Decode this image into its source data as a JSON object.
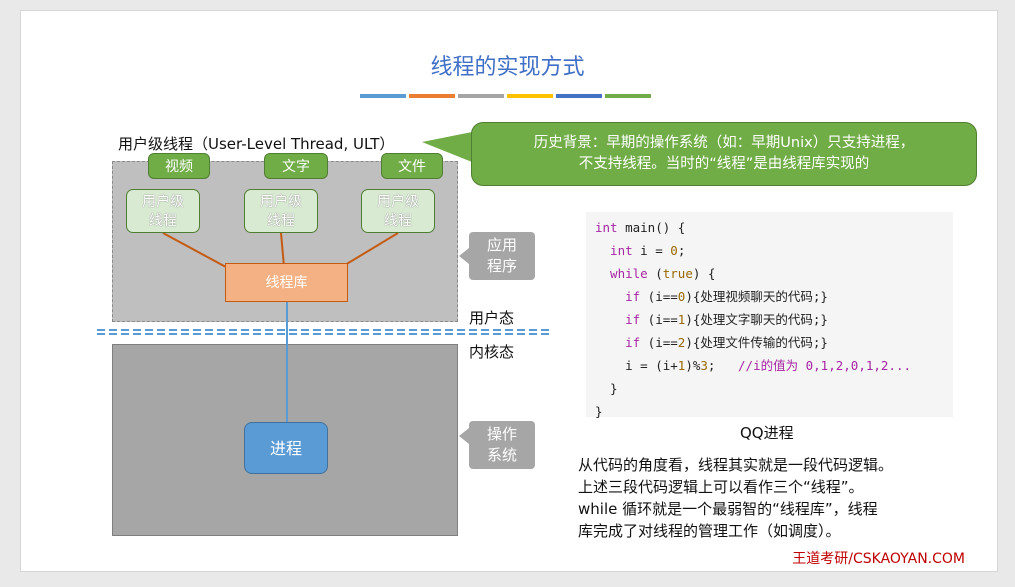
{
  "title": "线程的实现方式",
  "stripe_colors": [
    "#5b9bd5",
    "#ed7d31",
    "#a5a5a5",
    "#ffc000",
    "#4472c4",
    "#70ad47"
  ],
  "user_level_label": "用户级线程（User-Level Thread, ULT）",
  "callout": {
    "line1": "历史背景：早期的操作系统（如：早期Unix）只支持进程，",
    "line2": "不支持线程。当时的“线程”是由线程库实现的"
  },
  "tags": [
    "视频",
    "文字",
    "文件"
  ],
  "thread_label": {
    "line1": "用户级",
    "line2": "线程"
  },
  "thread_library": "线程库",
  "process": "进程",
  "app_label": {
    "line1": "应用",
    "line2": "程序"
  },
  "os_label": {
    "line1": "操作",
    "line2": "系统"
  },
  "user_mode": "用户态",
  "kernel_mode": "内核态",
  "code": {
    "l1a": "int",
    "l1b": " main() {",
    "l2a": "  int",
    "l2b": " i = ",
    "l2c": "0",
    "l2d": ";",
    "l3a": "  while",
    "l3b": " (",
    "l3c": "true",
    "l3d": ") {",
    "l4a": "    if",
    "l4b": " (i==",
    "l4c": "0",
    "l4d": "){处理视频聊天的代码;}",
    "l5a": "    if",
    "l5b": " (i==",
    "l5c": "1",
    "l5d": "){处理文字聊天的代码;}",
    "l6a": "    if",
    "l6b": " (i==",
    "l6c": "2",
    "l6d": "){处理文件传输的代码;}",
    "l7a": "    i = (i+",
    "l7b": "1",
    "l7c": ")%",
    "l7d": "3",
    "l7e": ";   ",
    "l7f": "//i的值为 0,1,2,0,1,2...",
    "l8": "  }",
    "l9": "}"
  },
  "code_caption": "QQ进程",
  "explanation": {
    "line1": "从代码的角度看，线程其实就是一段代码逻辑。",
    "line2": "上述三段代码逻辑上可以看作三个“线程”。",
    "line3": "while 循环就是一个最弱智的“线程库”，线程",
    "line4": "库完成了对线程的管理工作（如调度）。"
  },
  "brand": "王道考研/CSKAOYAN.COM"
}
